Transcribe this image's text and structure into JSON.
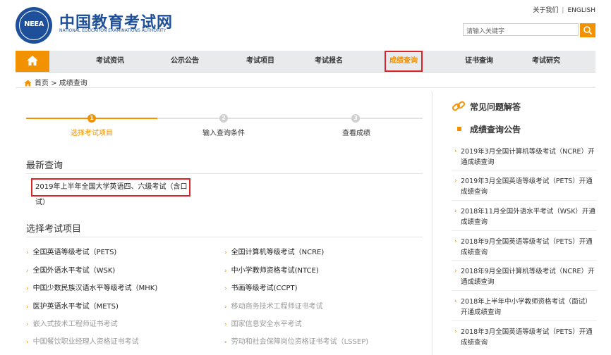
{
  "header": {
    "logo_text": "NEEA",
    "site_title": "中国教育考试网",
    "site_subtitle": "NATIONAL EDUCATION EXAMINATIONS AUTHORITY",
    "links": [
      "关于我们",
      "ENGLISH"
    ],
    "search_placeholder": "请输入关键字"
  },
  "nav": {
    "items": [
      "考试资讯",
      "公示公告",
      "考试项目",
      "考试报名",
      "成绩查询",
      "证书查询",
      "考试研究"
    ],
    "active_index": 4
  },
  "breadcrumb": {
    "home": "首页",
    "separator": ">",
    "current": "成绩查询"
  },
  "steps": [
    {
      "num": "1",
      "label": "选择考试项目"
    },
    {
      "num": "2",
      "label": "输入查询条件"
    },
    {
      "num": "3",
      "label": "查看成绩"
    }
  ],
  "latest": {
    "title": "最新查询",
    "item": "2019年上半年全国大学英语四、六级考试（含口试）"
  },
  "projects": {
    "title": "选择考试项目",
    "left": [
      {
        "label": "全国英语等级考试（PETS)",
        "enabled": true
      },
      {
        "label": "全国外语水平考试（WSK)",
        "enabled": true
      },
      {
        "label": "中国少数民族汉语水平等级考试（MHK)",
        "enabled": true
      },
      {
        "label": "医护英语水平考试（METS)",
        "enabled": true
      },
      {
        "label": "嵌入式技术工程师证书考试",
        "enabled": false
      },
      {
        "label": "中国餐饮职业经理人资格证书考试",
        "enabled": false
      }
    ],
    "right": [
      {
        "label": "全国计算机等级考试（NCRE)",
        "enabled": true
      },
      {
        "label": "中小学教师资格考试(NTCE)",
        "enabled": true
      },
      {
        "label": "书画等级考试(CCPT)",
        "enabled": true
      },
      {
        "label": "移动商务技术工程师证书考试",
        "enabled": false
      },
      {
        "label": "国家信息安全水平考试",
        "enabled": false
      },
      {
        "label": "劳动和社会保障岗位资格证书考试（LSSEP)",
        "enabled": false
      }
    ]
  },
  "sidebar": {
    "faq_title": "常见问题解答",
    "announce_title": "成绩查询公告",
    "items": [
      "2019年3月全国计算机等级考试（NCRE）开通成绩查询",
      "2019年3月全国英语等级考试（PETS）开通成绩查询",
      "2018年11月全国外语水平考试（WSK）开通成绩查询",
      "2018年9月全国英语等级考试（PETS）开通成绩查询",
      "2018年9月全国计算机等级考试（NCRE）开通成绩查询",
      "2018年上半年中小学教师资格考试（面试）开通成绩查询",
      "2018年3月全国英语等级考试（PETS）开通成绩查询"
    ]
  },
  "colors": {
    "accent": "#f39200",
    "highlight_border": "#d9252a",
    "brand_blue": "#1e4f9a",
    "nav_bg": "#e9eaec"
  }
}
